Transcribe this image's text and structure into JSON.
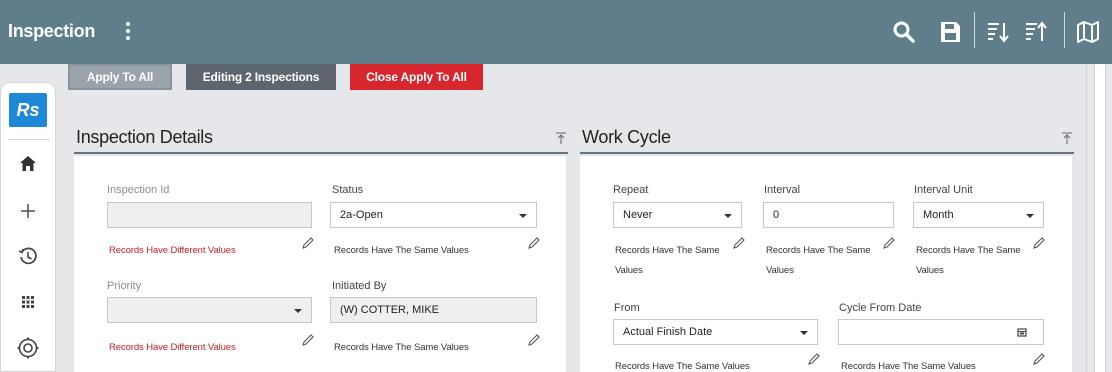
{
  "header": {
    "title": "Inspection",
    "icons": [
      "kebab-menu-icon",
      "search-icon",
      "save-icon",
      "sort-descending-icon",
      "sort-ascending-icon",
      "map-icon"
    ]
  },
  "nav": {
    "logo": "Rs",
    "items": [
      "home-icon",
      "add-icon",
      "history-icon",
      "apps-grid-icon",
      "settings-icon"
    ]
  },
  "actions": {
    "apply_all": "Apply To All",
    "editing": "Editing 2 Inspections",
    "close_apply": "Close Apply To All"
  },
  "inspection_details": {
    "title": "Inspection Details",
    "inspection_id": {
      "label": "Inspection Id",
      "value": "",
      "note": "Records Have Different Values"
    },
    "status": {
      "label": "Status",
      "value": "2a-Open",
      "note": "Records Have The Same Values"
    },
    "priority": {
      "label": "Priority",
      "value": "",
      "note": "Records Have Different Values"
    },
    "initiated_by": {
      "label": "Initiated By",
      "value": "(W) COTTER, MIKE",
      "note": "Records Have The Same Values"
    }
  },
  "work_cycle": {
    "title": "Work Cycle",
    "repeat": {
      "label": "Repeat",
      "value": "Never",
      "note_line1": "Records Have The Same",
      "note_line2": "Values"
    },
    "interval": {
      "label": "Interval",
      "value": "0",
      "note_line1": "Records Have The Same",
      "note_line2": "Values"
    },
    "interval_unit": {
      "label": "Interval Unit",
      "value": "Month",
      "note_line1": "Records Have The Same",
      "note_line2": "Values"
    },
    "from": {
      "label": "From",
      "value": "Actual Finish Date",
      "note": "Records Have The Same Values"
    },
    "cycle_from_date": {
      "label": "Cycle From Date",
      "value": "",
      "note": "Records Have The Same Values"
    }
  },
  "colors": {
    "header_bg": "#607d8b",
    "accent_blue": "#1f88d6",
    "danger_red": "#d7262e",
    "diff_text_red": "#c0212a"
  }
}
